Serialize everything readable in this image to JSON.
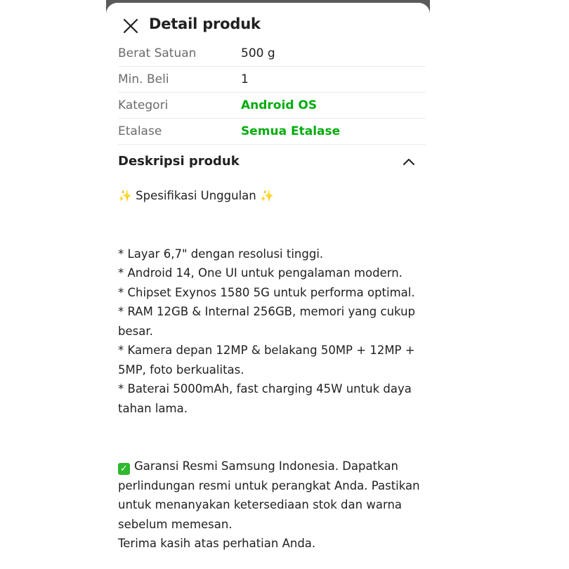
{
  "header": {
    "title": "Detail produk",
    "close_icon": "close-icon"
  },
  "info": [
    {
      "label": "Berat Satuan",
      "value": "500 g",
      "link": false
    },
    {
      "label": "Min. Beli",
      "value": "1",
      "link": false
    },
    {
      "label": "Kategori",
      "value": "Android OS",
      "link": true
    },
    {
      "label": "Etalase",
      "value": "Semua Etalase",
      "link": true
    }
  ],
  "description": {
    "title": "Deskripsi produk",
    "toggle_icon": "chevron-up-icon",
    "intro": "Spesifikasi Unggulan",
    "intro_icon": "sparkles-icon",
    "specs": [
      "* Layar 6,7\" dengan resolusi tinggi.",
      "* Android 14, One UI untuk pengalaman modern.",
      "* Chipset Exynos 1580 5G untuk performa optimal.",
      "* RAM 12GB & Internal 256GB, memori yang cukup besar.",
      "* Kamera depan 12MP & belakang 50MP + 12MP + 5MP, foto berkualitas.",
      "* Baterai 5000mAh, fast charging 45W untuk daya tahan lama."
    ],
    "warranty_icon": "check-mark-icon",
    "warranty": "Garansi Resmi Samsung Indonesia. Dapatkan perlindungan resmi untuk perangkat Anda. Pastikan untuk menanyakan ketersediaan stok dan warna sebelum memesan.",
    "thanks": "Terima kasih atas perhatian Anda."
  },
  "colors": {
    "accent_green": "#03ac0e",
    "text_primary": "#212121",
    "text_secondary": "#6b6b6b"
  }
}
